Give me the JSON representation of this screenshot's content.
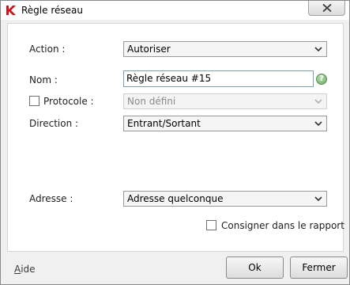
{
  "window": {
    "title": "Règle réseau",
    "app_icon": "kaspersky-k-icon",
    "close_icon": "close-icon"
  },
  "form": {
    "action": {
      "label": "Action :",
      "value": "Autoriser"
    },
    "name": {
      "label": "Nom :",
      "value": "Règle réseau #15"
    },
    "protocol": {
      "label": "Protocole :",
      "value": "Non défini",
      "checked": false,
      "enabled": false
    },
    "direction": {
      "label": "Direction :",
      "value": "Entrant/Sortant"
    },
    "address": {
      "label": "Adresse :",
      "value": "Adresse quelconque"
    },
    "log": {
      "label": "Consigner dans le rapport",
      "checked": false
    }
  },
  "footer": {
    "help_first": "A",
    "help_rest": "ide",
    "ok_label": "Ok",
    "close_label": "Fermer"
  },
  "colors": {
    "brand": "#c4161c",
    "help_icon": "#6aa960"
  }
}
